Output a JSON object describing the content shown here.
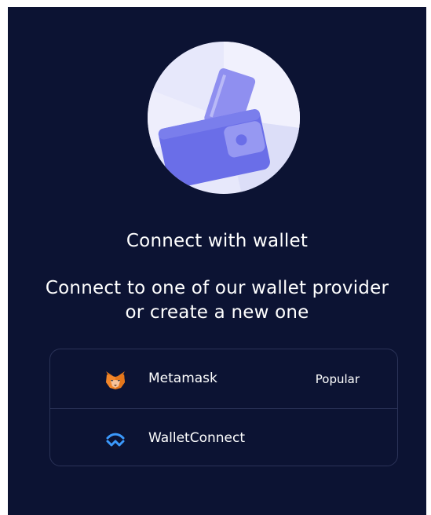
{
  "modal": {
    "title": "Connect with wallet",
    "subtitle_line1": "Connect to one of our wallet provider",
    "subtitle_line2": "or create a new one",
    "hero_icon": "wallet-with-card-icon"
  },
  "providers": [
    {
      "label": "Metamask",
      "badge": "Popular",
      "icon": "metamask-fox-icon"
    },
    {
      "label": "WalletConnect",
      "badge": "",
      "icon": "walletconnect-icon"
    }
  ],
  "colors": {
    "background": "#0c1333",
    "circle": "#e7e8fb",
    "wallet": "#6a6ee8",
    "text": "#ffffff",
    "border": "#2b3358",
    "metamask_orange": "#f2862a",
    "walletconnect_blue": "#3b99fc"
  }
}
